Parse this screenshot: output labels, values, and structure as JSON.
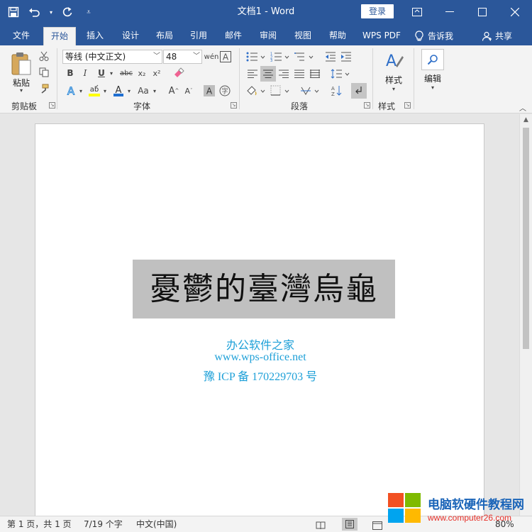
{
  "titlebar": {
    "title": "文档1  -  Word",
    "login_label": "登录",
    "bg": "#2b579a"
  },
  "tabs": [
    {
      "label": "文件",
      "active": false
    },
    {
      "label": "开始",
      "active": true
    },
    {
      "label": "插入",
      "active": false
    },
    {
      "label": "设计",
      "active": false
    },
    {
      "label": "布局",
      "active": false
    },
    {
      "label": "引用",
      "active": false
    },
    {
      "label": "邮件",
      "active": false
    },
    {
      "label": "审阅",
      "active": false
    },
    {
      "label": "视图",
      "active": false
    },
    {
      "label": "帮助",
      "active": false
    },
    {
      "label": "WPS PDF",
      "active": false
    }
  ],
  "tell_me": "告诉我",
  "share": "共享",
  "ribbon": {
    "clipboard": {
      "label": "剪贴板",
      "paste": "粘贴"
    },
    "font": {
      "label": "字体",
      "font_name": "等线 (中文正文)",
      "font_size": "48"
    },
    "paragraph": {
      "label": "段落"
    },
    "styles": {
      "label": "样式",
      "button": "样式"
    },
    "editing": {
      "button": "编辑"
    }
  },
  "document": {
    "heading": "憂鬱的臺灣烏龜",
    "watermark_lines": [
      "办公软件之家",
      "www.wps-office.net",
      "豫 ICP 备 170229703 号"
    ]
  },
  "statusbar": {
    "page": "第 1 页，共 1 页",
    "words": "7/19 个字",
    "language": "中文(中国)",
    "zoom": "80%"
  },
  "logo": {
    "name": "电脑软硬件教程网",
    "url": "www.computer26.com"
  },
  "colors": {
    "accent": "#2b579a",
    "watermark": "#1ea0d8",
    "highlight": "#c0c0c0"
  }
}
